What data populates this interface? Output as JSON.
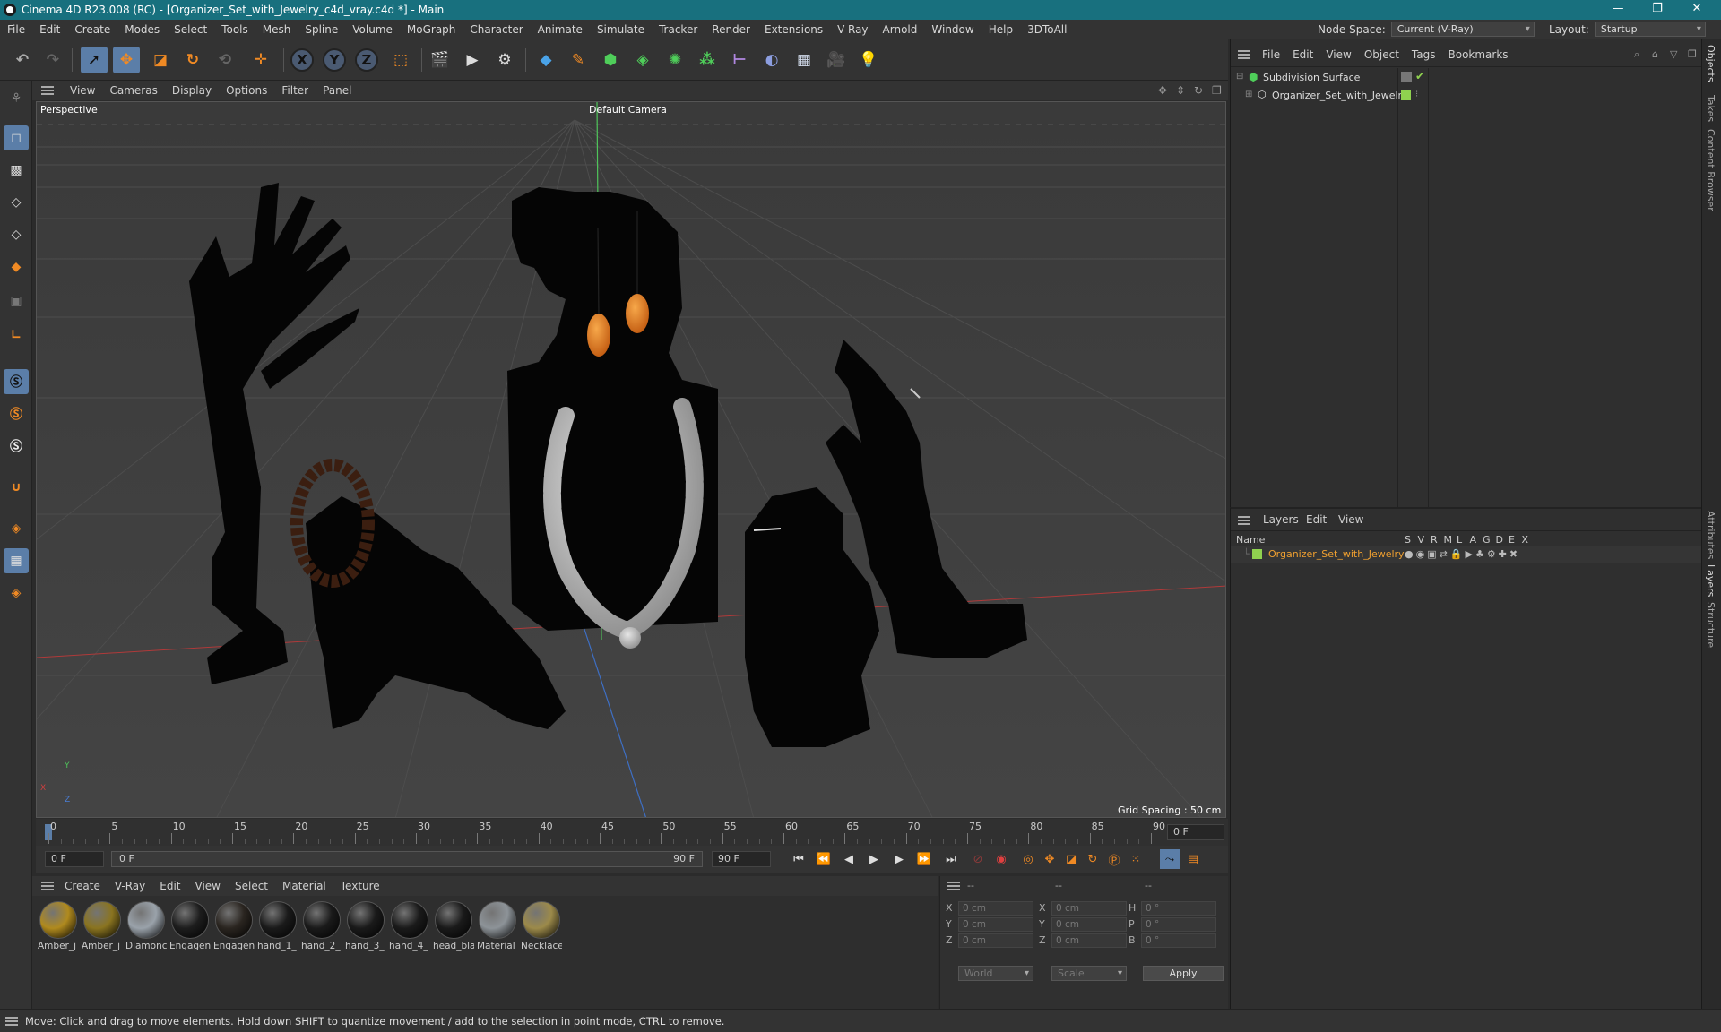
{
  "window": {
    "title": "Cinema 4D R23.008 (RC) - [Organizer_Set_with_Jewelry_c4d_vray.c4d *] - Main",
    "controls": [
      "—",
      "❐",
      "✕"
    ]
  },
  "menubar": {
    "items": [
      "File",
      "Edit",
      "Create",
      "Modes",
      "Select",
      "Tools",
      "Mesh",
      "Spline",
      "Volume",
      "MoGraph",
      "Character",
      "Animate",
      "Simulate",
      "Tracker",
      "Render",
      "Extensions",
      "V-Ray",
      "Arnold",
      "Window",
      "Help",
      "3DToAll"
    ],
    "node_space_label": "Node Space:",
    "node_space_value": "Current (V-Ray)",
    "layout_label": "Layout:",
    "layout_value": "Startup"
  },
  "viewport": {
    "menu": [
      "View",
      "Cameras",
      "Display",
      "Options",
      "Filter",
      "Panel"
    ],
    "view_name": "Perspective",
    "camera": "Default Camera",
    "grid_spacing": "Grid Spacing : 50 cm",
    "axis_labels": {
      "x": "X",
      "y": "Y",
      "z": "Z"
    }
  },
  "timeline": {
    "ticks": [
      "0",
      "5",
      "10",
      "15",
      "20",
      "25",
      "30",
      "35",
      "40",
      "45",
      "50",
      "55",
      "60",
      "65",
      "70",
      "75",
      "80",
      "85",
      "90"
    ],
    "current_frame": "0 F",
    "start_field": "0 F",
    "range_start": "0 F",
    "range_end": "90 F",
    "end_field": "90 F"
  },
  "material_manager": {
    "menu": [
      "Create",
      "V-Ray",
      "Edit",
      "View",
      "Select",
      "Material",
      "Texture"
    ],
    "materials": [
      {
        "label": "Amber_j",
        "color": "#b08a1e"
      },
      {
        "label": "Amber_j",
        "color": "#8a7420"
      },
      {
        "label": "Diamonc",
        "color": "#9aa2aa"
      },
      {
        "label": "Engagen",
        "color": "#1d1d1d"
      },
      {
        "label": "Engagen",
        "color": "#2a2520"
      },
      {
        "label": "hand_1_",
        "color": "#1a1a1a"
      },
      {
        "label": "hand_2_",
        "color": "#1a1a1a"
      },
      {
        "label": "hand_3_",
        "color": "#1a1a1a"
      },
      {
        "label": "hand_4_",
        "color": "#1a1a1a"
      },
      {
        "label": "head_bla",
        "color": "#1a1a1a"
      },
      {
        "label": "Material",
        "color": "#8d9398"
      },
      {
        "label": "Necklace",
        "color": "#9c8a4a"
      }
    ]
  },
  "coordinates": {
    "headers": [
      "--",
      "--",
      "--"
    ],
    "rows": [
      {
        "a": "X",
        "av": "0 cm",
        "b": "X",
        "bv": "0 cm",
        "c": "H",
        "cv": "0 °"
      },
      {
        "a": "Y",
        "av": "0 cm",
        "b": "Y",
        "bv": "0 cm",
        "c": "P",
        "cv": "0 °"
      },
      {
        "a": "Z",
        "av": "0 cm",
        "b": "Z",
        "bv": "0 cm",
        "c": "B",
        "cv": "0 °"
      }
    ],
    "mode1": "World",
    "mode2": "Scale",
    "apply": "Apply"
  },
  "objects_panel": {
    "menu": [
      "File",
      "Edit",
      "View",
      "Object",
      "Tags",
      "Bookmarks"
    ],
    "items": [
      {
        "name": "Subdivision Surface"
      },
      {
        "name": "Organizer_Set_with_Jewelry"
      }
    ]
  },
  "layers_panel": {
    "menu": [
      "Layers",
      "Edit",
      "View"
    ],
    "col_name": "Name",
    "cols": [
      "S",
      "V",
      "R",
      "M",
      "L",
      "A",
      "G",
      "D",
      "E",
      "X"
    ],
    "layers": [
      {
        "name": "Organizer_Set_with_Jewelry",
        "color": "#8fd14f"
      }
    ]
  },
  "side_tabs": {
    "top": [
      "Objects",
      "Takes",
      "Content Browser"
    ],
    "bottom": [
      "Attributes",
      "Layers",
      "Structure"
    ]
  },
  "status": "Move: Click and drag to move elements. Hold down SHIFT to quantize movement / add to the selection in point mode, CTRL to remove.",
  "colors": {
    "titlebar": "#18707e",
    "accent_orange": "#f08a24",
    "layer_text": "#f0a030",
    "green": "#8fd14f"
  }
}
